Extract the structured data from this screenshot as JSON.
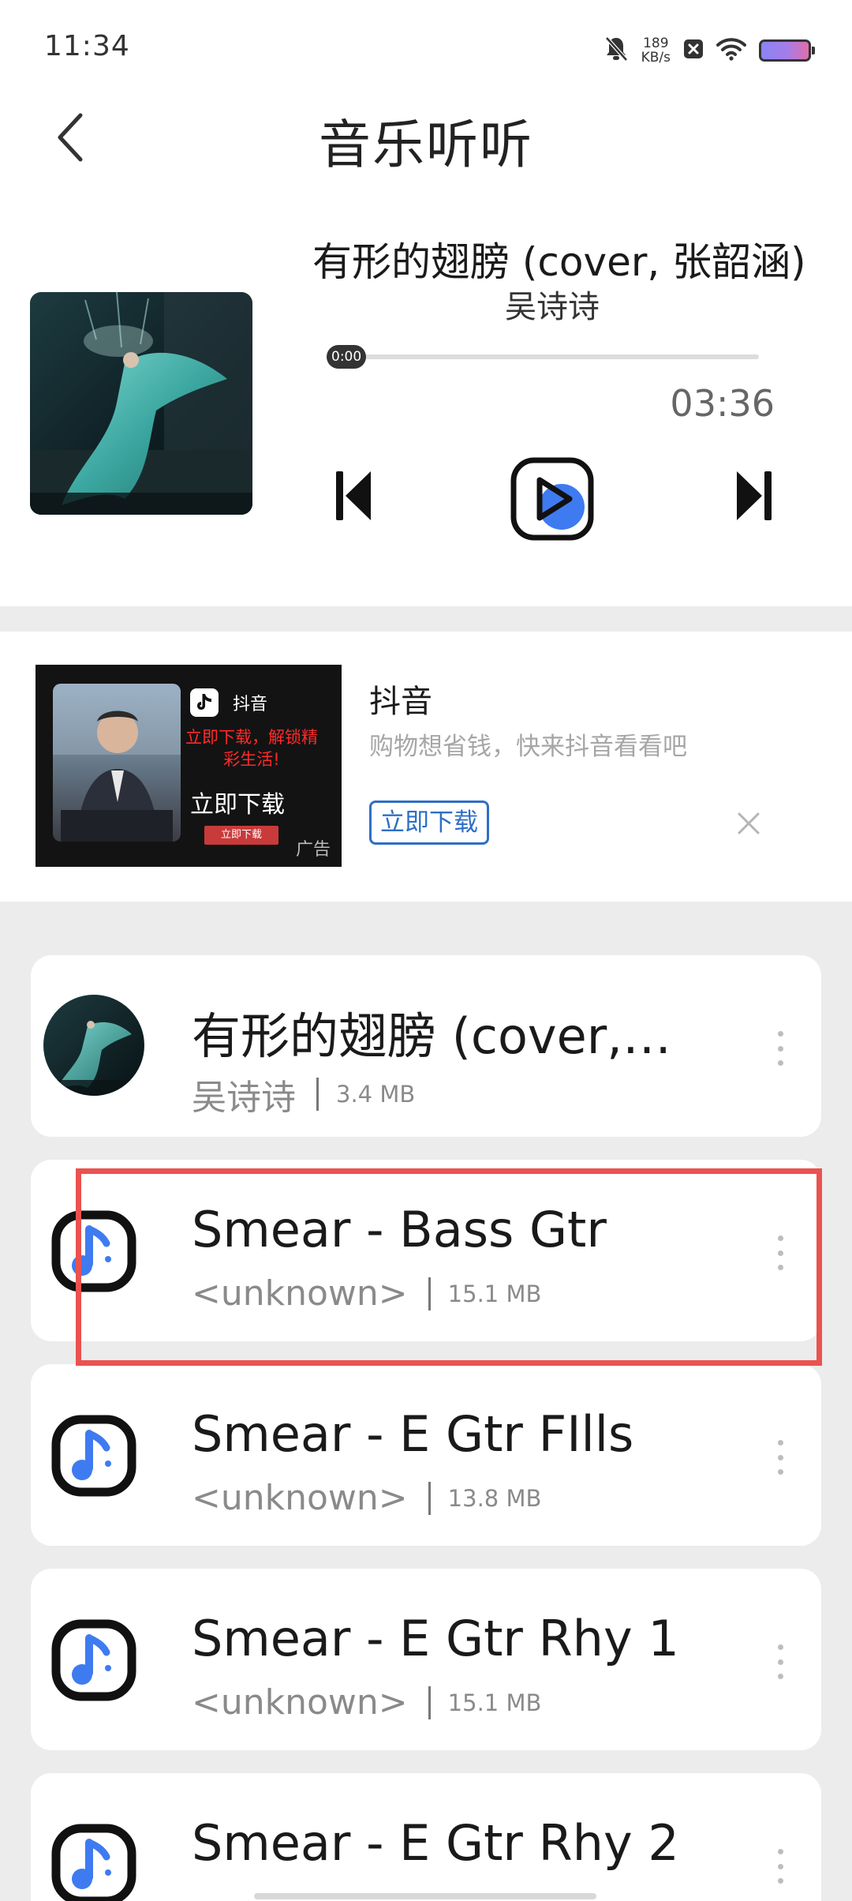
{
  "status_bar": {
    "time": "11:34",
    "net_speed_value": "189",
    "net_speed_unit": "KB/s",
    "icons": [
      "bell-off-icon",
      "network-speed",
      "close-box-icon",
      "wifi-icon",
      "battery-icon"
    ]
  },
  "header": {
    "title": "音乐听听",
    "back_icon": "chevron-left-icon"
  },
  "player": {
    "track_title": "有形的翅膀 (cover, 张韶涵)",
    "artist": "吴诗诗",
    "current_time": "0:00",
    "duration": "03:36",
    "progress_fraction": 0,
    "controls": [
      "skip-previous-icon",
      "play-icon",
      "skip-next-icon"
    ]
  },
  "ad": {
    "title": "抖音",
    "description": "购物想省钱，快来抖音看看吧",
    "button_label": "立即下载",
    "close_icon": "close-icon",
    "image": {
      "brand": "抖音",
      "red_text_line1": "立即下载，解锁精",
      "red_text_line2": "彩生活!",
      "download_text": "立即下载",
      "small_button": "立即下载",
      "ad_label": "广告"
    }
  },
  "songs": [
    {
      "title": "有形的翅膀 (cover,…",
      "artist": "吴诗诗",
      "size": "3.4 MB",
      "thumb": "album-art"
    },
    {
      "title": "Smear - Bass Gtr",
      "artist": "<unknown>",
      "size": "15.1 MB",
      "thumb": "music-note-icon"
    },
    {
      "title": "Smear - E Gtr FIlls",
      "artist": "<unknown>",
      "size": "13.8 MB",
      "thumb": "music-note-icon"
    },
    {
      "title": "Smear - E Gtr Rhy 1",
      "artist": "<unknown>",
      "size": "15.1 MB",
      "thumb": "music-note-icon"
    },
    {
      "title": "Smear - E Gtr Rhy 2",
      "artist": "",
      "size": "",
      "thumb": "music-note-icon"
    }
  ],
  "colors": {
    "accent_blue": "#3f7bf0",
    "highlight_red": "#ea5250",
    "ad_button_blue": "#2e6fc6"
  }
}
